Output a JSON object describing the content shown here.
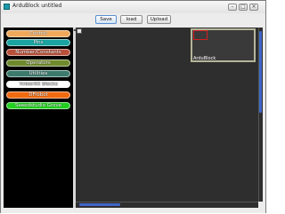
{
  "window": {
    "title": "ArduBlock untitled",
    "controls": {
      "minimize": "–",
      "maximize": "□",
      "close": "×"
    }
  },
  "toolbar": {
    "save_label": "Save",
    "load_label": "load",
    "upload_label": "Upload"
  },
  "palette": {
    "categories": [
      {
        "label": "Control",
        "color": "#f0a85a"
      },
      {
        "label": "Pins",
        "color": "#1aa3a0"
      },
      {
        "label": "Number/Constants",
        "color": "#b8503a"
      },
      {
        "label": "Operators",
        "color": "#6f8a2d"
      },
      {
        "label": "Utilities",
        "color": "#3d7a6e"
      },
      {
        "label": "TinkerKit Blocks",
        "color": "#ffffff"
      },
      {
        "label": "DFrobot",
        "color": "#f06a10"
      },
      {
        "label": "Seeedstudio Grove",
        "color": "#22d020"
      }
    ]
  },
  "canvas": {
    "background": "#2e2e2e",
    "minimap_label": "ArduBlock",
    "scroll_accent": "#3f67c8"
  },
  "icons": {
    "app": "ardublock-app-icon",
    "splitter": "splitter-arrow-icon"
  }
}
